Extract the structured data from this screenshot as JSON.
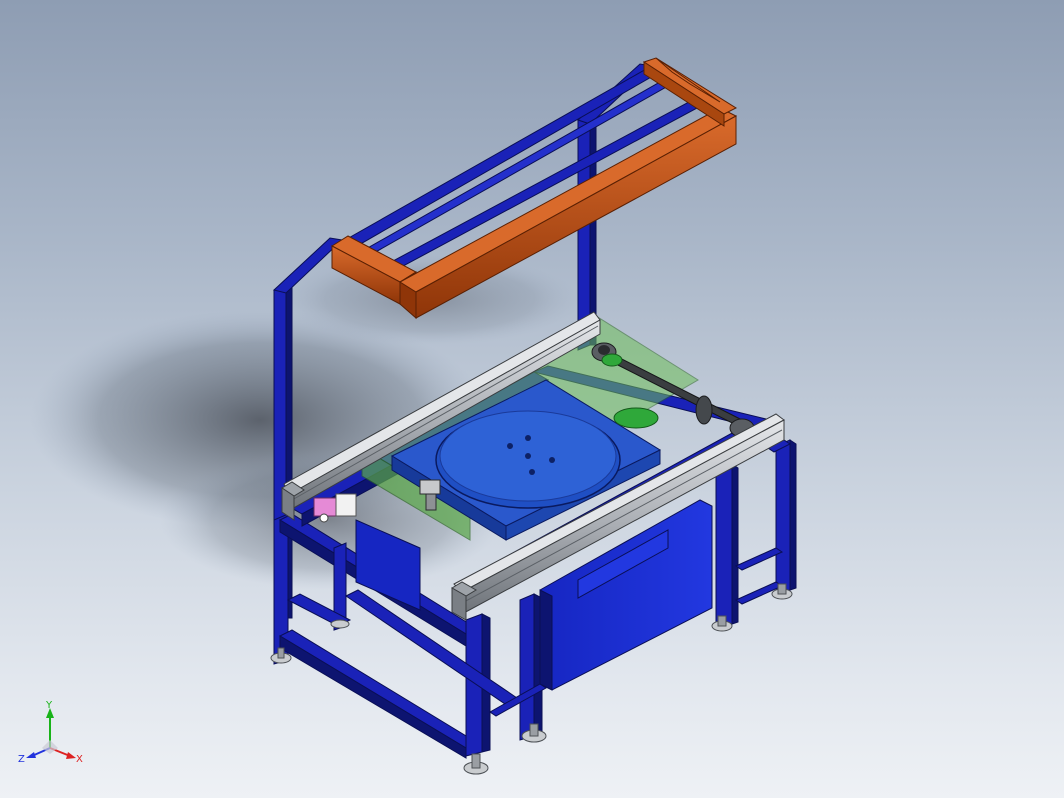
{
  "viewport": {
    "background_top": "#8e9db3",
    "background_bottom": "#eef1f5"
  },
  "model": {
    "frame_color": "#1a22b8",
    "frame_dark": "#0d1470",
    "frame_light": "#3a45e0",
    "overhead_beam_color": "#b4460e",
    "rail_color": "#b5b9bf",
    "turntable_color": "#1f4fc4",
    "guard_color": "#6fbf5a",
    "enclosure_color": "#1a2bd0",
    "feet_color": "#c9cccf",
    "sensor_color": "#e58ad6",
    "shaft_color": "#3a3d40"
  },
  "triad": {
    "y_label": "Y",
    "z_label": "Z",
    "x_label": "X",
    "y_color": "#19b319",
    "z_color": "#2233dd",
    "x_color": "#dd2222"
  }
}
